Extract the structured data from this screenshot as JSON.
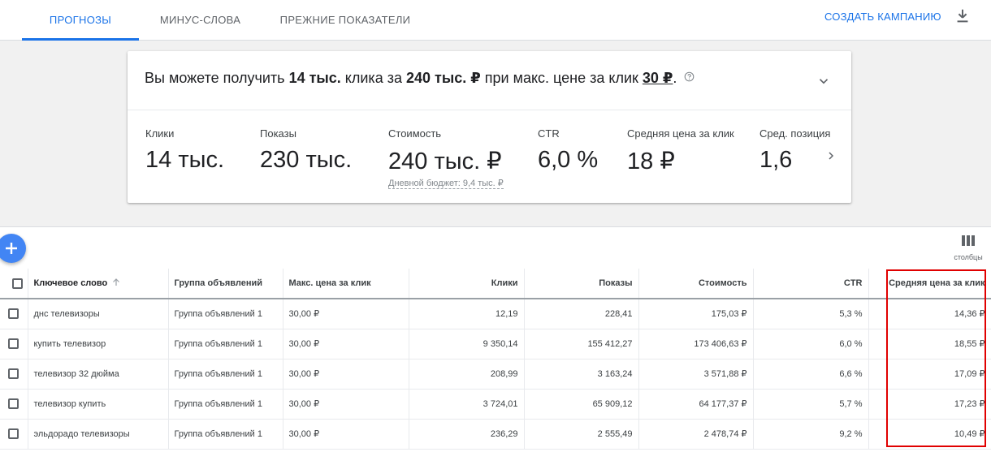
{
  "tabs": [
    {
      "label": "Прогнозы",
      "active": true
    },
    {
      "label": "Минус-слова",
      "active": false
    },
    {
      "label": "Прежние показатели",
      "active": false
    }
  ],
  "header": {
    "create_campaign": "Создать кампанию",
    "download_icon": "download-icon"
  },
  "summary": {
    "headline_prefix": "Вы можете получить ",
    "clicks": "14 тыс.",
    "mid1": " клика за ",
    "cost": "240 тыс. ₽",
    "mid2": " при макс. цене за клик ",
    "max_cpc": "30 ₽",
    "end": ".",
    "metrics": [
      {
        "label": "Клики",
        "value": "14 тыс."
      },
      {
        "label": "Показы",
        "value": "230 тыс."
      },
      {
        "label": "Стоимость",
        "value": "240 тыс. ₽",
        "sub": "Дневной бюджет: 9,4 тыс. ₽"
      },
      {
        "label": "CTR",
        "value": "6,0 %"
      },
      {
        "label": "Средняя цена за клик",
        "value": "18 ₽"
      },
      {
        "label": "Сред. позиция",
        "value": "1,6"
      }
    ]
  },
  "toolbar": {
    "columns_label": "столбцы"
  },
  "table": {
    "columns": [
      "Ключевое слово",
      "Группа объявлений",
      "Макс. цена за клик",
      "Клики",
      "Показы",
      "Стоимость",
      "CTR",
      "Средняя цена за клик"
    ],
    "rows": [
      [
        "днс телевизоры",
        "Группа объявлений 1",
        "30,00 ₽",
        "12,19",
        "228,41",
        "175,03 ₽",
        "5,3 %",
        "14,36 ₽"
      ],
      [
        "купить телевизор",
        "Группа объявлений 1",
        "30,00 ₽",
        "9 350,14",
        "155 412,27",
        "173 406,63 ₽",
        "6,0 %",
        "18,55 ₽"
      ],
      [
        "телевизор 32 дюйма",
        "Группа объявлений 1",
        "30,00 ₽",
        "208,99",
        "3 163,24",
        "3 571,88 ₽",
        "6,6 %",
        "17,09 ₽"
      ],
      [
        "телевизор купить",
        "Группа объявлений 1",
        "30,00 ₽",
        "3 724,01",
        "65 909,12",
        "64 177,37 ₽",
        "5,7 %",
        "17,23 ₽"
      ],
      [
        "эльдорадо телевизоры",
        "Группа объявлений 1",
        "30,00 ₽",
        "236,29",
        "2 555,49",
        "2 478,74 ₽",
        "9,2 %",
        "10,49 ₽"
      ]
    ]
  },
  "colors": {
    "accent": "#1a73e8",
    "fab": "#4285f4",
    "highlight": "#e00000"
  }
}
